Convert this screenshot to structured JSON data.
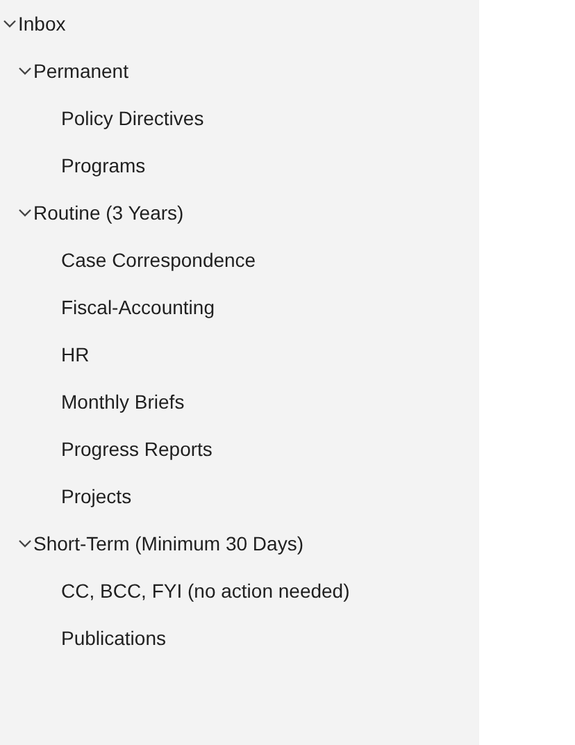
{
  "folders": [
    {
      "label": "Inbox",
      "expanded": true,
      "children": [
        {
          "label": "Permanent",
          "expanded": true,
          "children": [
            {
              "label": "Policy Directives"
            },
            {
              "label": "Programs"
            }
          ]
        },
        {
          "label": "Routine (3 Years)",
          "expanded": true,
          "children": [
            {
              "label": "Case Correspondence"
            },
            {
              "label": "Fiscal-Accounting"
            },
            {
              "label": "HR"
            },
            {
              "label": "Monthly Briefs"
            },
            {
              "label": "Progress Reports"
            },
            {
              "label": "Projects"
            }
          ]
        },
        {
          "label": "Short-Term (Minimum 30 Days)",
          "expanded": true,
          "children": [
            {
              "label": "CC, BCC, FYI (no action needed)"
            },
            {
              "label": "Publications"
            }
          ]
        }
      ]
    }
  ]
}
